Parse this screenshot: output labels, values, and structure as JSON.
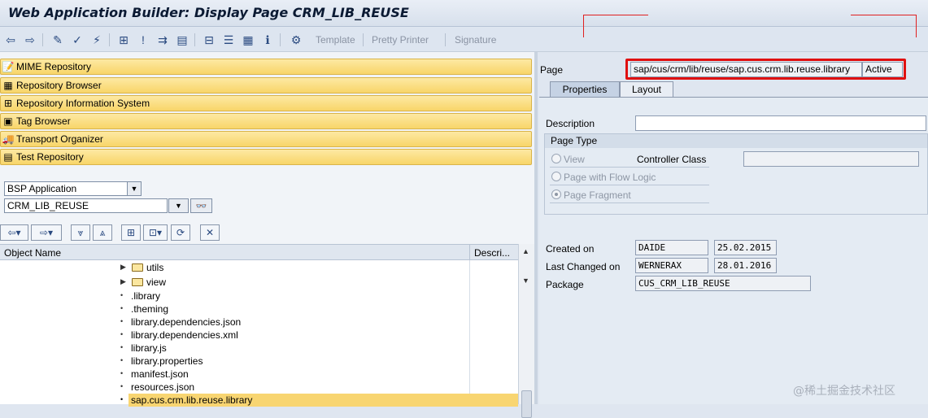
{
  "window": {
    "title": "Web Application Builder: Display Page CRM_LIB_REUSE"
  },
  "toolbar": {
    "template_label": "Template",
    "pretty_printer_label": "Pretty Printer",
    "signature_label": "Signature"
  },
  "navigator": [
    {
      "label": "MIME Repository",
      "icon": "mime-icon"
    },
    {
      "label": "Repository Browser",
      "icon": "browser-icon"
    },
    {
      "label": "Repository Information System",
      "icon": "info-system-icon"
    },
    {
      "label": "Tag Browser",
      "icon": "tag-icon"
    },
    {
      "label": "Transport Organizer",
      "icon": "truck-icon"
    },
    {
      "label": "Test Repository",
      "icon": "test-icon"
    }
  ],
  "object_selector": {
    "type_value": "BSP Application",
    "name_value": "CRM_LIB_REUSE"
  },
  "tree": {
    "headers": {
      "object_name": "Object Name",
      "description": "Descri..."
    },
    "rows": [
      {
        "label": "utils",
        "kind": "folder"
      },
      {
        "label": "view",
        "kind": "folder"
      },
      {
        "label": ".library",
        "kind": "file"
      },
      {
        "label": ".theming",
        "kind": "file"
      },
      {
        "label": "library.dependencies.json",
        "kind": "file"
      },
      {
        "label": "library.dependencies.xml",
        "kind": "file"
      },
      {
        "label": "library.js",
        "kind": "file"
      },
      {
        "label": "library.properties",
        "kind": "file"
      },
      {
        "label": "manifest.json",
        "kind": "file"
      },
      {
        "label": "resources.json",
        "kind": "file"
      },
      {
        "label": "sap.cus.crm.lib.reuse.library",
        "kind": "file",
        "selected": true
      }
    ]
  },
  "page": {
    "label": "Page",
    "value": "sap/cus/crm/lib/reuse/sap.cus.crm.lib.reuse.library",
    "status": "Active"
  },
  "tabs": [
    {
      "label": "Properties",
      "active": true
    },
    {
      "label": "Layout",
      "active": false
    }
  ],
  "properties": {
    "description_label": "Description",
    "description_value": "",
    "page_type_title": "Page Type",
    "options": [
      {
        "label": "View",
        "selected": false
      },
      {
        "label": "Page with Flow Logic",
        "selected": false
      },
      {
        "label": "Page Fragment",
        "selected": true
      }
    ],
    "controller_class_label": "Controller Class",
    "controller_class_value": "",
    "created_on_label": "Created on",
    "created_by": "DAIDE",
    "created_date": "25.02.2015",
    "last_changed_label": "Last Changed on",
    "changed_by": "WERNERAX",
    "changed_date": "28.01.2016",
    "package_label": "Package",
    "package_value": "CUS_CRM_LIB_REUSE"
  },
  "watermark": "@稀土掘金技术社区",
  "colors": {
    "highlight": "#e01010",
    "nav_yellow": "#f8d569",
    "selected_row": "#f8d571"
  }
}
